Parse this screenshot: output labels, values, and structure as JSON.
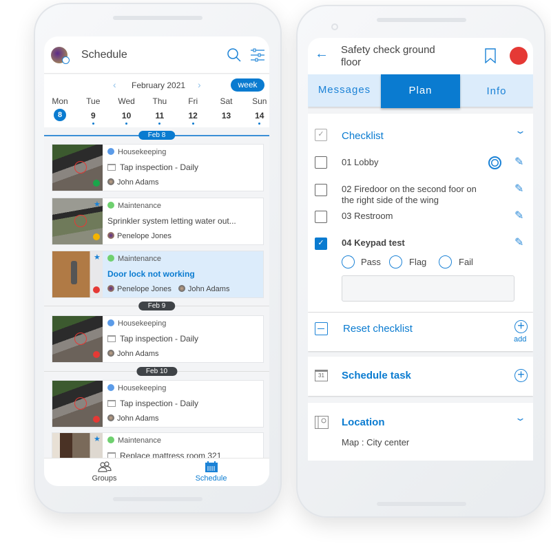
{
  "left_phone": {
    "header": {
      "title": "Schedule"
    },
    "calendar": {
      "month": "February 2021",
      "view_button": "week",
      "days": [
        {
          "name": "Mon",
          "num": "8",
          "selected": true,
          "has_events": false
        },
        {
          "name": "Tue",
          "num": "9",
          "has_events": true
        },
        {
          "name": "Wed",
          "num": "10",
          "has_events": true
        },
        {
          "name": "Thu",
          "num": "11",
          "has_events": true
        },
        {
          "name": "Fri",
          "num": "12",
          "has_events": true
        },
        {
          "name": "Sat",
          "num": "13",
          "has_events": false
        },
        {
          "name": "Sun",
          "num": "14",
          "has_events": true
        }
      ]
    },
    "date_labels": [
      "Feb 8",
      "Feb 9",
      "Feb 10"
    ],
    "cards": [
      {
        "category": "Housekeeping",
        "category_color": "#5b9be8",
        "title": "Tap inspection - Daily",
        "recurring": true,
        "people": [
          "John Adams"
        ],
        "status_color": "#1aa64a",
        "starred": false,
        "selected": false
      },
      {
        "category": "Maintenance",
        "category_color": "#6fd06f",
        "title": "Sprinkler system letting water out...",
        "recurring": false,
        "people": [
          "Penelope Jones"
        ],
        "status_color": "#f5b400",
        "starred": true,
        "selected": false
      },
      {
        "category": "Maintenance",
        "category_color": "#6fd06f",
        "title": "Door lock not working",
        "recurring": false,
        "people": [
          "Penelope Jones",
          "John Adams"
        ],
        "status_color": "#e53935",
        "starred": true,
        "selected": true
      },
      {
        "category": "Housekeeping",
        "category_color": "#5b9be8",
        "title": "Tap inspection - Daily",
        "recurring": true,
        "people": [
          "John Adams"
        ],
        "status_color": "#e53935",
        "starred": false,
        "selected": false
      },
      {
        "category": "Housekeeping",
        "category_color": "#5b9be8",
        "title": "Tap inspection - Daily",
        "recurring": true,
        "people": [
          "John Adams"
        ],
        "status_color": "#e53935",
        "starred": false,
        "selected": false
      },
      {
        "category": "Maintenance",
        "category_color": "#6fd06f",
        "title": "Replace mattress room 321",
        "recurring": true,
        "people": [],
        "status_color": "",
        "starred": true,
        "selected": false
      }
    ],
    "bottom_nav": [
      {
        "label": "Groups",
        "icon": "groups-icon",
        "active": false
      },
      {
        "label": "Schedule",
        "icon": "calendar-icon",
        "active": true
      }
    ]
  },
  "right_phone": {
    "header": {
      "title": "Safety check ground floor",
      "status_color": "#e53935"
    },
    "tabs": [
      {
        "label": "Messages",
        "active": false
      },
      {
        "label": "Plan",
        "active": true
      },
      {
        "label": "Info",
        "active": false
      }
    ],
    "checklist": {
      "title": "Checklist",
      "items": [
        {
          "label": "01 Lobby",
          "checked": false
        },
        {
          "label": "02 Firedoor on the second foor on the right side of the wing",
          "checked": false
        },
        {
          "label": "03 Restroom",
          "checked": false
        },
        {
          "label": "04 Keypad test",
          "checked": true
        }
      ],
      "options": [
        "Pass",
        "Flag",
        "Fail"
      ],
      "comment_value": ""
    },
    "reset": {
      "label": "Reset checklist",
      "add_label": "add"
    },
    "schedule_task": {
      "label": "Schedule task",
      "calendar_day": "31"
    },
    "location": {
      "label": "Location",
      "value": "Map : City center"
    },
    "accent": "#0a7bd0"
  }
}
